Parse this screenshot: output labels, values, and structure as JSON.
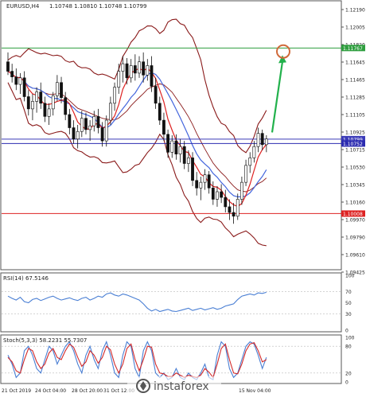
{
  "chart_data": [
    {
      "type": "candlestick",
      "title": "EURUSD,H4",
      "ohlc_header": "1.10748 1.10810 1.10748 1.10799",
      "ylim": [
        1.0942,
        1.1226
      ],
      "y_ticks": [
        "1.12190",
        "1.12005",
        "1.11820",
        "1.11645",
        "1.11465",
        "1.11285",
        "1.11105",
        "1.10925",
        "1.10715",
        "1.10530",
        "1.10345",
        "1.10160",
        "1.09970",
        "1.09790",
        "1.09610",
        "1.09425"
      ],
      "x_ticks": [
        "21 Oct 2019",
        "24 Oct 04:00",
        "28 Oct 20:00",
        "31 Oct 12:00",
        "15 Nov 04:00"
      ],
      "horizontal_levels": [
        {
          "price": 1.11767,
          "label": "1.11767",
          "color": "#2e9e3e"
        },
        {
          "price": 1.10799,
          "label": "1.10799",
          "color": "#3a3ab8"
        },
        {
          "price": 1.10752,
          "label": "1.10752",
          "color": "#2b2bb0"
        },
        {
          "price": 1.10008,
          "label": "1.10008",
          "color": "#dd2222"
        }
      ],
      "target_marker": {
        "price": 1.1173,
        "color": "#d06a3a"
      },
      "candles": [
        [
          1.1162,
          1.1172,
          1.1148,
          1.1152
        ],
        [
          1.1152,
          1.116,
          1.114,
          1.1146
        ],
        [
          1.1146,
          1.1155,
          1.1132,
          1.1138
        ],
        [
          1.1138,
          1.115,
          1.1128,
          1.1145
        ],
        [
          1.1145,
          1.1152,
          1.112,
          1.1125
        ],
        [
          1.1125,
          1.1132,
          1.1105,
          1.1112
        ],
        [
          1.1112,
          1.1128,
          1.11,
          1.112
        ],
        [
          1.112,
          1.1135,
          1.1108,
          1.113
        ],
        [
          1.113,
          1.114,
          1.1112,
          1.1118
        ],
        [
          1.1118,
          1.1125,
          1.1098,
          1.1104
        ],
        [
          1.1104,
          1.1118,
          1.1095,
          1.1112
        ],
        [
          1.1112,
          1.113,
          1.1105,
          1.1126
        ],
        [
          1.1126,
          1.1148,
          1.112,
          1.114
        ],
        [
          1.114,
          1.1146,
          1.1118,
          1.1124
        ],
        [
          1.1124,
          1.113,
          1.11,
          1.1106
        ],
        [
          1.1106,
          1.1112,
          1.1085,
          1.1092
        ],
        [
          1.1092,
          1.11,
          1.1075,
          1.108
        ],
        [
          1.108,
          1.1095,
          1.107,
          1.1088
        ],
        [
          1.1088,
          1.111,
          1.1082,
          1.1102
        ],
        [
          1.1102,
          1.1108,
          1.1085,
          1.109
        ],
        [
          1.109,
          1.11,
          1.1078,
          1.1094
        ],
        [
          1.1094,
          1.111,
          1.1088,
          1.1104
        ],
        [
          1.1104,
          1.1112,
          1.1086,
          1.1092
        ],
        [
          1.1092,
          1.1098,
          1.1072,
          1.1078
        ],
        [
          1.1078,
          1.1105,
          1.1072,
          1.11
        ],
        [
          1.11,
          1.1125,
          1.1095,
          1.1118
        ],
        [
          1.1118,
          1.114,
          1.111,
          1.1135
        ],
        [
          1.1135,
          1.116,
          1.1128,
          1.1152
        ],
        [
          1.1152,
          1.1168,
          1.114,
          1.116
        ],
        [
          1.116,
          1.1166,
          1.1138,
          1.1145
        ],
        [
          1.1145,
          1.1165,
          1.114,
          1.1158
        ],
        [
          1.1158,
          1.117,
          1.1142,
          1.115
        ],
        [
          1.115,
          1.1168,
          1.1145,
          1.1162
        ],
        [
          1.1162,
          1.1172,
          1.114,
          1.1148
        ],
        [
          1.1148,
          1.1165,
          1.1142,
          1.1158
        ],
        [
          1.1158,
          1.1168,
          1.113,
          1.1136
        ],
        [
          1.1136,
          1.1145,
          1.1112,
          1.1118
        ],
        [
          1.1118,
          1.1125,
          1.1095,
          1.11
        ],
        [
          1.11,
          1.1108,
          1.1078,
          1.1085
        ],
        [
          1.1085,
          1.109,
          1.106,
          1.1066
        ],
        [
          1.1066,
          1.1084,
          1.106,
          1.1078
        ],
        [
          1.1078,
          1.1085,
          1.1058,
          1.1064
        ],
        [
          1.1064,
          1.108,
          1.1055,
          1.1072
        ],
        [
          1.1072,
          1.1078,
          1.1048,
          1.1054
        ],
        [
          1.1054,
          1.1068,
          1.1045,
          1.106
        ],
        [
          1.106,
          1.1066,
          1.103,
          1.1036
        ],
        [
          1.1036,
          1.1045,
          1.102,
          1.1028
        ],
        [
          1.1028,
          1.104,
          1.1015,
          1.1034
        ],
        [
          1.1034,
          1.1048,
          1.1026,
          1.1042
        ],
        [
          1.1042,
          1.1046,
          1.1022,
          1.1028
        ],
        [
          1.1028,
          1.1035,
          1.101,
          1.1016
        ],
        [
          1.1016,
          1.103,
          1.1008,
          1.1024
        ],
        [
          1.1024,
          1.1032,
          1.1012,
          1.1018
        ],
        [
          1.1018,
          1.1026,
          1.1002,
          1.1008
        ],
        [
          1.1008,
          1.1016,
          1.0994,
          1.1002
        ],
        [
          1.1002,
          1.1012,
          1.099,
          1.0998
        ],
        [
          1.0998,
          1.1022,
          1.0994,
          1.1016
        ],
        [
          1.1016,
          1.104,
          1.101,
          1.1034
        ],
        [
          1.1034,
          1.1058,
          1.103,
          1.1052
        ],
        [
          1.1052,
          1.1066,
          1.1044,
          1.106
        ],
        [
          1.106,
          1.1078,
          1.1055,
          1.1072
        ],
        [
          1.1072,
          1.1092,
          1.1066,
          1.1086
        ],
        [
          1.1086,
          1.109,
          1.1068,
          1.1074
        ],
        [
          1.1074,
          1.1084,
          1.1066,
          1.108
        ]
      ],
      "arrow": {
        "from_index": 64,
        "from_price": 1.1087,
        "to_price": 1.1169,
        "color": "#22b14c"
      }
    },
    {
      "type": "line",
      "title": "RSI(14) 67.5146",
      "ylim": [
        0,
        100
      ],
      "y_ticks": [
        "100",
        "70",
        "50",
        "30",
        "0"
      ],
      "series": [
        {
          "name": "RSI(14)",
          "color": "#4a7fd4",
          "values": [
            62,
            58,
            55,
            60,
            52,
            50,
            56,
            58,
            54,
            57,
            60,
            62,
            58,
            55,
            57,
            59,
            56,
            54,
            58,
            60,
            55,
            58,
            62,
            60,
            66,
            68,
            64,
            62,
            66,
            64,
            61,
            58,
            55,
            48,
            40,
            35,
            38,
            34,
            36,
            38,
            35,
            34,
            36,
            38,
            40,
            36,
            38,
            40,
            37,
            39,
            41,
            38,
            40,
            44,
            46,
            48,
            56,
            62,
            64,
            66,
            64,
            68,
            67,
            69
          ]
        }
      ]
    },
    {
      "type": "line",
      "title": "Stoch(5,3,3) 58.2231 55.7307",
      "ylim": [
        0,
        100
      ],
      "y_ticks": [
        "100",
        "80",
        "20",
        "0"
      ],
      "series": [
        {
          "name": "main",
          "color": "#4a7fd4",
          "values": [
            60,
            40,
            10,
            20,
            70,
            80,
            60,
            30,
            20,
            50,
            80,
            70,
            40,
            60,
            80,
            90,
            70,
            40,
            20,
            60,
            80,
            50,
            30,
            70,
            90,
            60,
            20,
            10,
            60,
            90,
            80,
            30,
            10,
            70,
            90,
            70,
            20,
            10,
            20,
            5,
            10,
            30,
            10,
            5,
            20,
            10,
            5,
            20,
            40,
            10,
            5,
            60,
            90,
            80,
            30,
            10,
            20,
            50,
            80,
            90,
            85,
            60,
            30,
            55
          ]
        },
        {
          "name": "signal",
          "color": "#d22a2a",
          "values": [
            55,
            45,
            25,
            20,
            50,
            75,
            70,
            45,
            30,
            40,
            65,
            75,
            55,
            50,
            70,
            85,
            78,
            55,
            35,
            45,
            70,
            60,
            42,
            55,
            80,
            72,
            40,
            20,
            40,
            75,
            85,
            50,
            25,
            50,
            80,
            78,
            40,
            20,
            18,
            12,
            12,
            20,
            15,
            10,
            15,
            12,
            10,
            15,
            30,
            22,
            10,
            40,
            75,
            85,
            50,
            20,
            18,
            40,
            70,
            85,
            88,
            70,
            45,
            50
          ]
        }
      ]
    }
  ],
  "watermark": "instaforex"
}
